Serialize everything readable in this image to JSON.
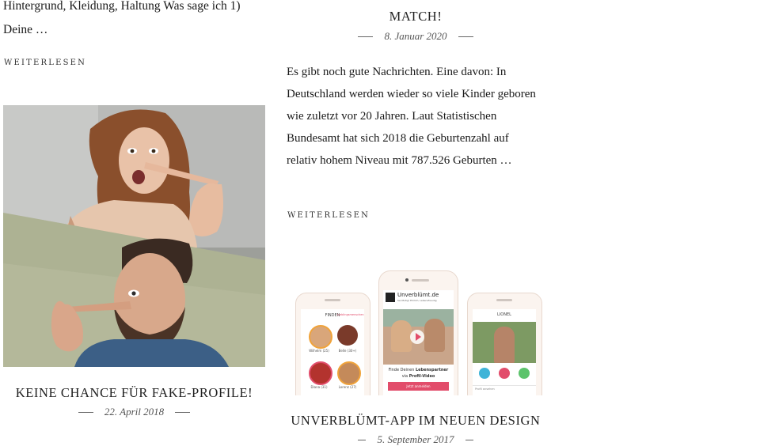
{
  "posts": [
    {
      "excerpt": "Hintergrund, Kleidung, Haltung Was sage ich 1) Deine …",
      "readmore": "Weiterlesen"
    },
    {
      "title": "Keine Chance für Fake-Profile!",
      "date": "22. April 2018",
      "image_alt": "Frau und Mann mit langer Pinocchio-Nase"
    },
    {
      "title": "MATCH!",
      "date": "8. Januar 2020",
      "excerpt": "Es gibt noch gute Nachrichten. Eine davon: In Deutschland werden wieder so viele Kinder geboren wie zuletzt vor 20 Jahren.  Laut Statistischen Bundesamt hat sich 2018 die Geburtenzahl auf relativ hohem Niveau mit 787.526 Geburten …",
      "readmore": "Weiterlesen"
    },
    {
      "title": "Unverblümt-App im neuen Design",
      "date": "5. September 2017",
      "app_screens": {
        "left_header": "FINDEN",
        "left_tab": "Lieblingsmenschen",
        "left_profiles": [
          "Wilhelm (25)",
          "Belle (30+)",
          "Diana (31)",
          "Lorenz (27)"
        ],
        "center_brand": "Unverblümt.de",
        "center_tagline": "Sei Mutig! Ehrlich, Lebensfreudig",
        "center_caption_1": "Finde Deinen",
        "center_caption_bold": "Lebenspartner",
        "center_caption_2": "via",
        "center_caption_bold2": "Profil-Video",
        "center_button": "Jetzt anmelden",
        "right_header": "LIONEL",
        "right_sub": "Profil ansehen"
      }
    }
  ],
  "colors": {
    "accent_pink": "#e24d6b",
    "text": "#1a1a1a"
  }
}
